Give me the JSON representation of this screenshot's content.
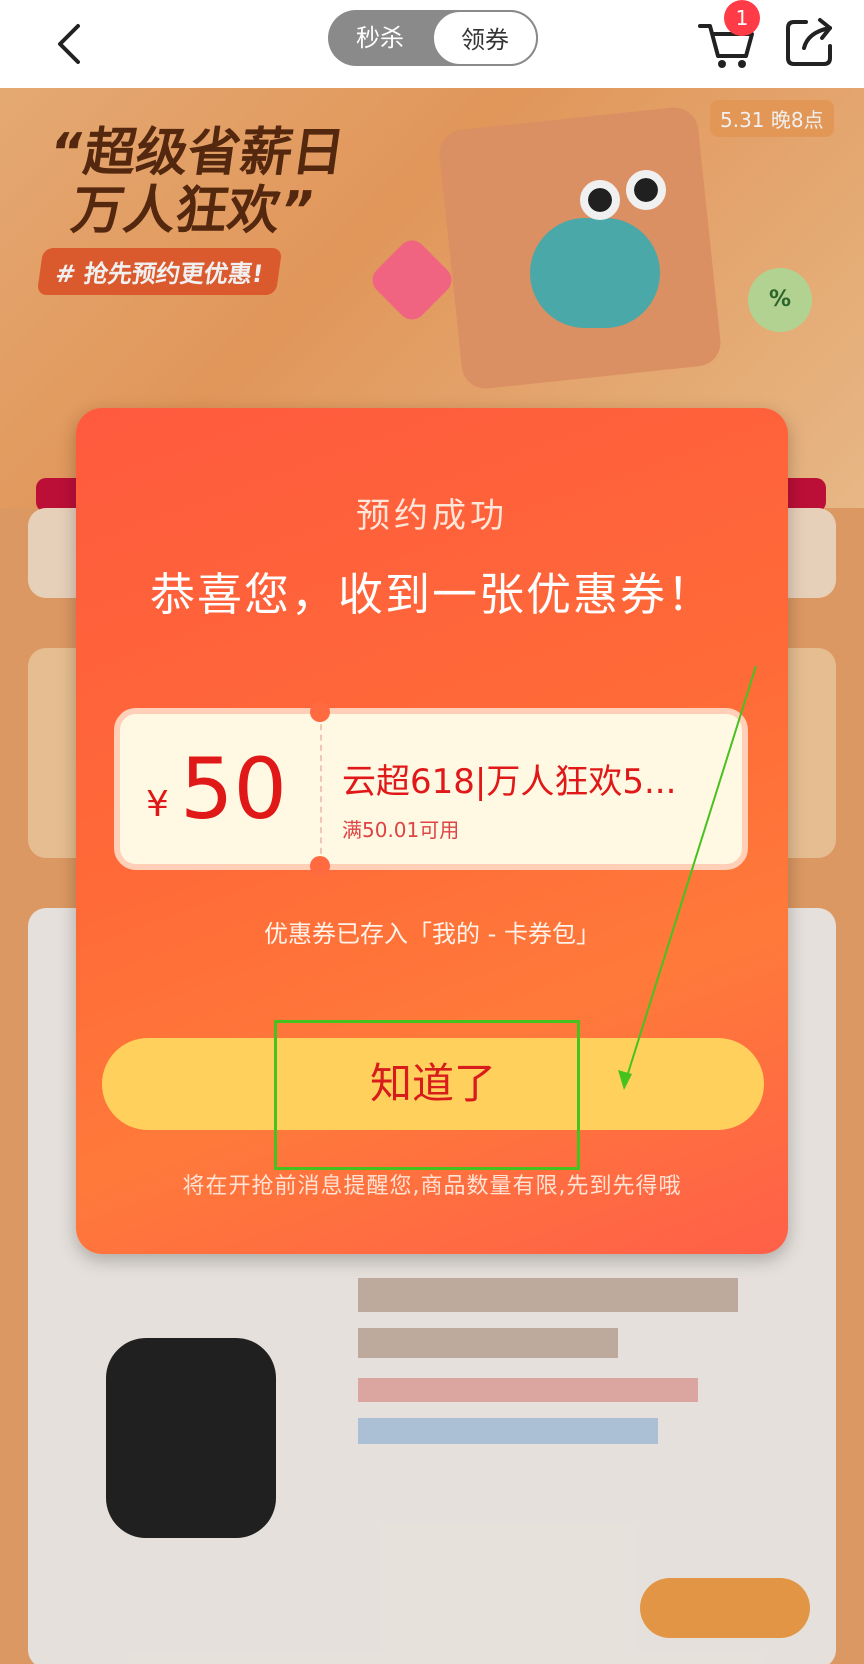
{
  "topbar": {
    "tabs": [
      {
        "label": "秒杀",
        "selected": false
      },
      {
        "label": "领券",
        "selected": true
      }
    ],
    "cart_badge": "1"
  },
  "banner": {
    "title_line1": "“超级省薪日",
    "title_line2": "万人狂欢”",
    "tag": "# 抢先预约更优惠!",
    "date": "5.31 晚8点",
    "percent_badge": "%"
  },
  "modal": {
    "title": "预约成功",
    "subtitle": "恭喜您，收到一张优惠券！",
    "coupon": {
      "currency": "¥",
      "amount": "50",
      "name": "云超618|万人狂欢5...",
      "condition": "满50.01可用"
    },
    "saved_note": "优惠券已存入「我的 - 卡券包」",
    "ok_label": "知道了",
    "hint": "将在开抢前消息提醒您,商品数量有限,先到先得哦"
  },
  "colors": {
    "modal_top": "#ff5a3e",
    "button_bg": "#ffd15c",
    "button_text": "#d81c1c",
    "coupon_text": "#e01818",
    "annotation": "#46c21f"
  }
}
